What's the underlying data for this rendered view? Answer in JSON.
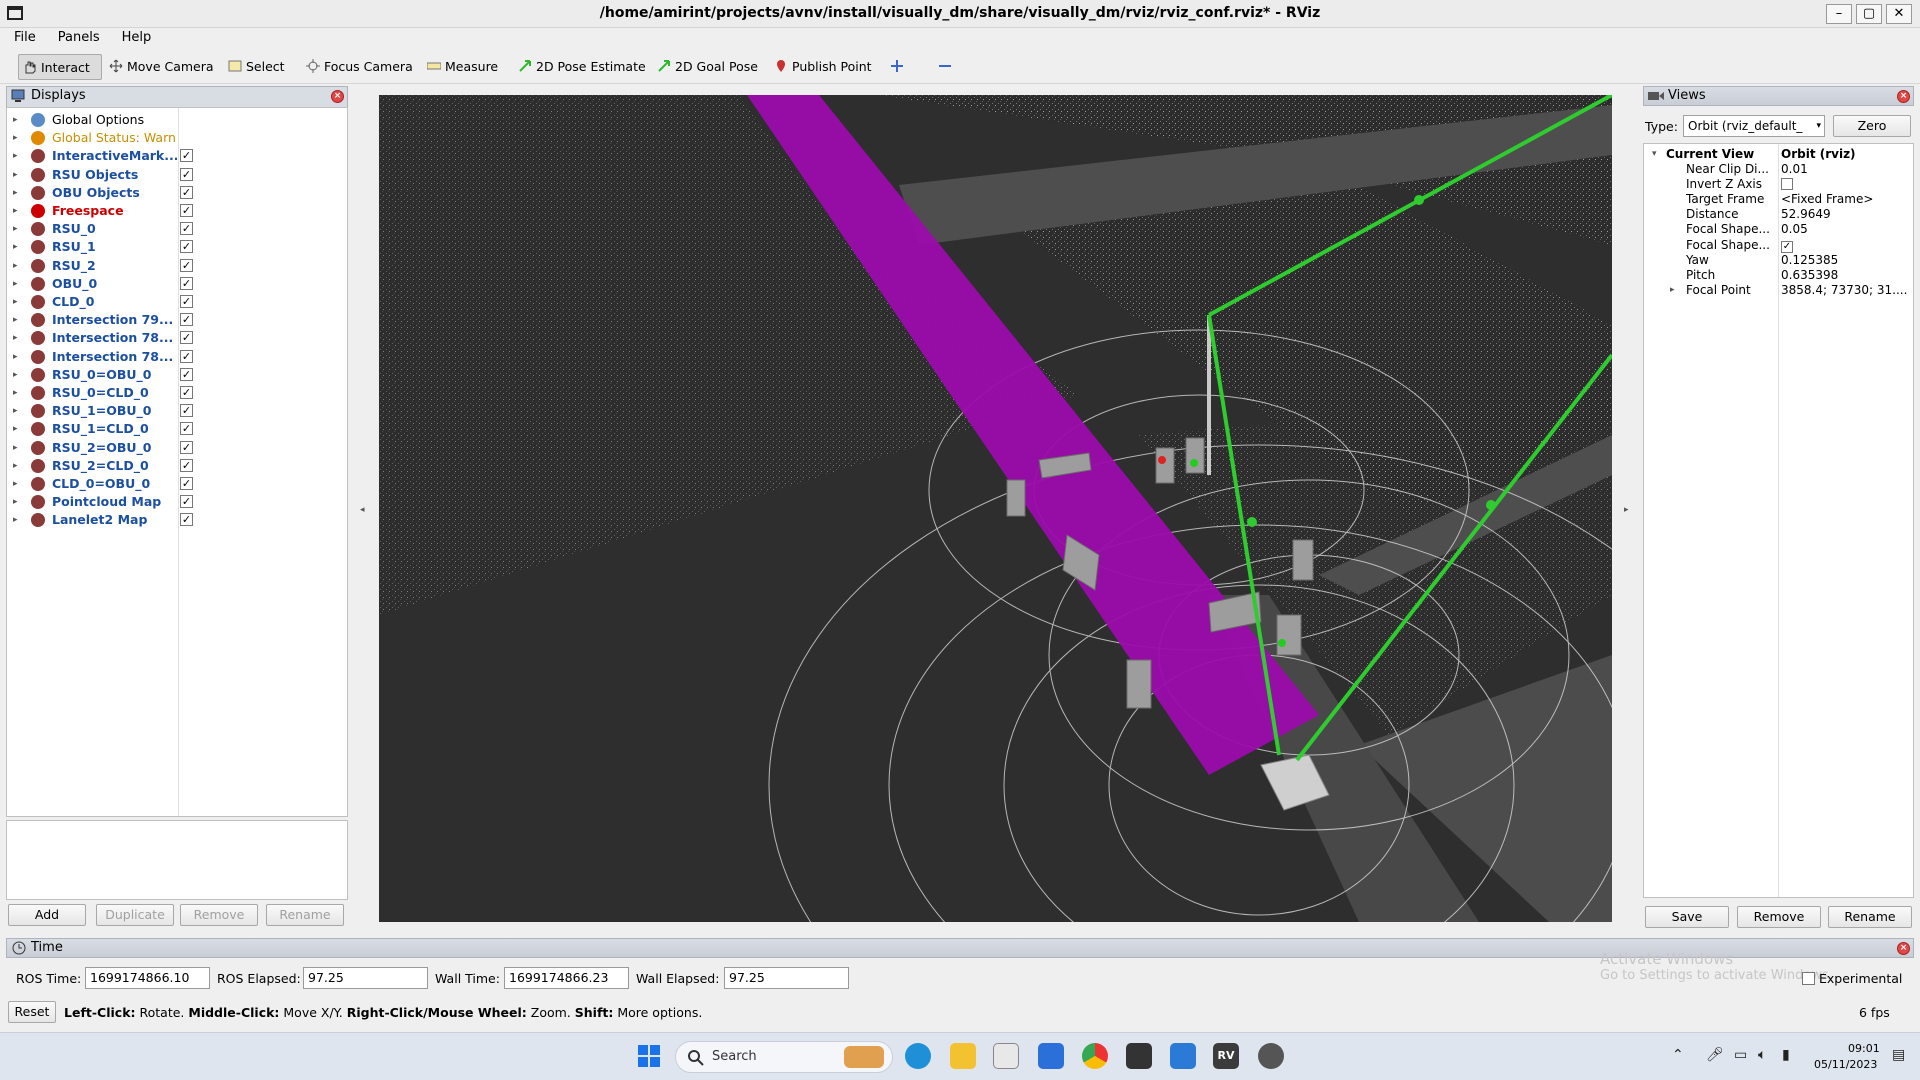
{
  "window": {
    "title": "/home/amirint/projects/avnv/install/visually_dm/share/visually_dm/rviz/rviz_conf.rviz* - RViz",
    "controls": [
      "minimize",
      "maximize",
      "close"
    ]
  },
  "menu": [
    "File",
    "Panels",
    "Help"
  ],
  "toolbar": {
    "items": [
      {
        "label": "Interact",
        "icon": "hand-icon",
        "active": true
      },
      {
        "label": "Move Camera",
        "icon": "move-camera-icon"
      },
      {
        "label": "Select",
        "icon": "select-icon"
      },
      {
        "label": "Focus Camera",
        "icon": "focus-camera-icon"
      },
      {
        "label": "Measure",
        "icon": "ruler-icon"
      },
      {
        "label": "2D Pose Estimate",
        "icon": "green-arrow-icon"
      },
      {
        "label": "2D Goal Pose",
        "icon": "green-arrow-icon"
      },
      {
        "label": "Publish Point",
        "icon": "map-pin-icon"
      }
    ]
  },
  "displays": {
    "title": "Displays",
    "items": [
      {
        "label": "Global Options",
        "style": "normal",
        "checkbox": null
      },
      {
        "label": "Global Status: Warn",
        "style": "warn",
        "checkbox": null
      },
      {
        "label": "InteractiveMark...",
        "style": "bold",
        "checkbox": true
      },
      {
        "label": "RSU Objects",
        "style": "bold",
        "checkbox": true
      },
      {
        "label": "OBU Objects",
        "style": "bold",
        "checkbox": true
      },
      {
        "label": "Freespace",
        "style": "error",
        "checkbox": true
      },
      {
        "label": "RSU_0",
        "style": "bold",
        "checkbox": true
      },
      {
        "label": "RSU_1",
        "style": "bold",
        "checkbox": true
      },
      {
        "label": "RSU_2",
        "style": "bold",
        "checkbox": true
      },
      {
        "label": "OBU_0",
        "style": "bold",
        "checkbox": true
      },
      {
        "label": "CLD_0",
        "style": "bold",
        "checkbox": true
      },
      {
        "label": "Intersection 79...",
        "style": "bold",
        "checkbox": true
      },
      {
        "label": "Intersection 78...",
        "style": "bold",
        "checkbox": true
      },
      {
        "label": "Intersection 78...",
        "style": "bold",
        "checkbox": true
      },
      {
        "label": "RSU_0=OBU_0",
        "style": "bold",
        "checkbox": true
      },
      {
        "label": "RSU_0=CLD_0",
        "style": "bold",
        "checkbox": true
      },
      {
        "label": "RSU_1=OBU_0",
        "style": "bold",
        "checkbox": true
      },
      {
        "label": "RSU_1=CLD_0",
        "style": "bold",
        "checkbox": true
      },
      {
        "label": "RSU_2=OBU_0",
        "style": "bold",
        "checkbox": true
      },
      {
        "label": "RSU_2=CLD_0",
        "style": "bold",
        "checkbox": true
      },
      {
        "label": "CLD_0=OBU_0",
        "style": "bold",
        "checkbox": true
      },
      {
        "label": "Pointcloud Map",
        "style": "bold",
        "checkbox": true
      },
      {
        "label": "Lanelet2 Map",
        "style": "bold",
        "checkbox": true
      }
    ],
    "buttons": {
      "add": "Add",
      "duplicate": "Duplicate",
      "remove": "Remove",
      "rename": "Rename"
    }
  },
  "views": {
    "title": "Views",
    "type_label": "Type:",
    "type_value": "Orbit (rviz_default_",
    "zero": "Zero",
    "current_view": {
      "key": "Current View",
      "value": "Orbit (rviz)"
    },
    "props": [
      {
        "key": "Near Clip Di...",
        "value": "0.01"
      },
      {
        "key": "Invert Z Axis",
        "value": "",
        "checkbox": false
      },
      {
        "key": "Target Frame",
        "value": "<Fixed Frame>"
      },
      {
        "key": "Distance",
        "value": "52.9649"
      },
      {
        "key": "Focal Shape...",
        "value": "0.05"
      },
      {
        "key": "Focal Shape...",
        "value": "",
        "checkbox": true
      },
      {
        "key": "Yaw",
        "value": "0.125385"
      },
      {
        "key": "Pitch",
        "value": "0.635398"
      },
      {
        "key": "Focal Point",
        "value": "3858.4; 73730; 31...."
      }
    ],
    "buttons": {
      "save": "Save",
      "remove": "Remove",
      "rename": "Rename"
    }
  },
  "time": {
    "title": "Time",
    "ros_time_label": "ROS Time:",
    "ros_time": "1699174866.10",
    "ros_elapsed_label": "ROS Elapsed:",
    "ros_elapsed": "97.25",
    "wall_time_label": "Wall Time:",
    "wall_time": "1699174866.23",
    "wall_elapsed_label": "Wall Elapsed:",
    "wall_elapsed": "97.25",
    "experimental": "Experimental",
    "activate_line1": "Activate Windows",
    "activate_line2": "Go to Settings to activate Windows."
  },
  "statusbar": {
    "reset": "Reset",
    "hint_1b": "Left-Click:",
    "hint_1": " Rotate. ",
    "hint_2b": "Middle-Click:",
    "hint_2": " Move X/Y. ",
    "hint_3b": "Right-Click/Mouse Wheel:",
    "hint_3": " Zoom. ",
    "hint_4b": "Shift:",
    "hint_4": " More options.",
    "fps": "6 fps"
  },
  "taskbar": {
    "search_placeholder": "Search",
    "time": "09:01",
    "date": "05/11/2023"
  },
  "colors": {
    "freespace": "#9b0cab",
    "links": "#2fcc2f",
    "accent_blue": "#1c4fa0"
  }
}
